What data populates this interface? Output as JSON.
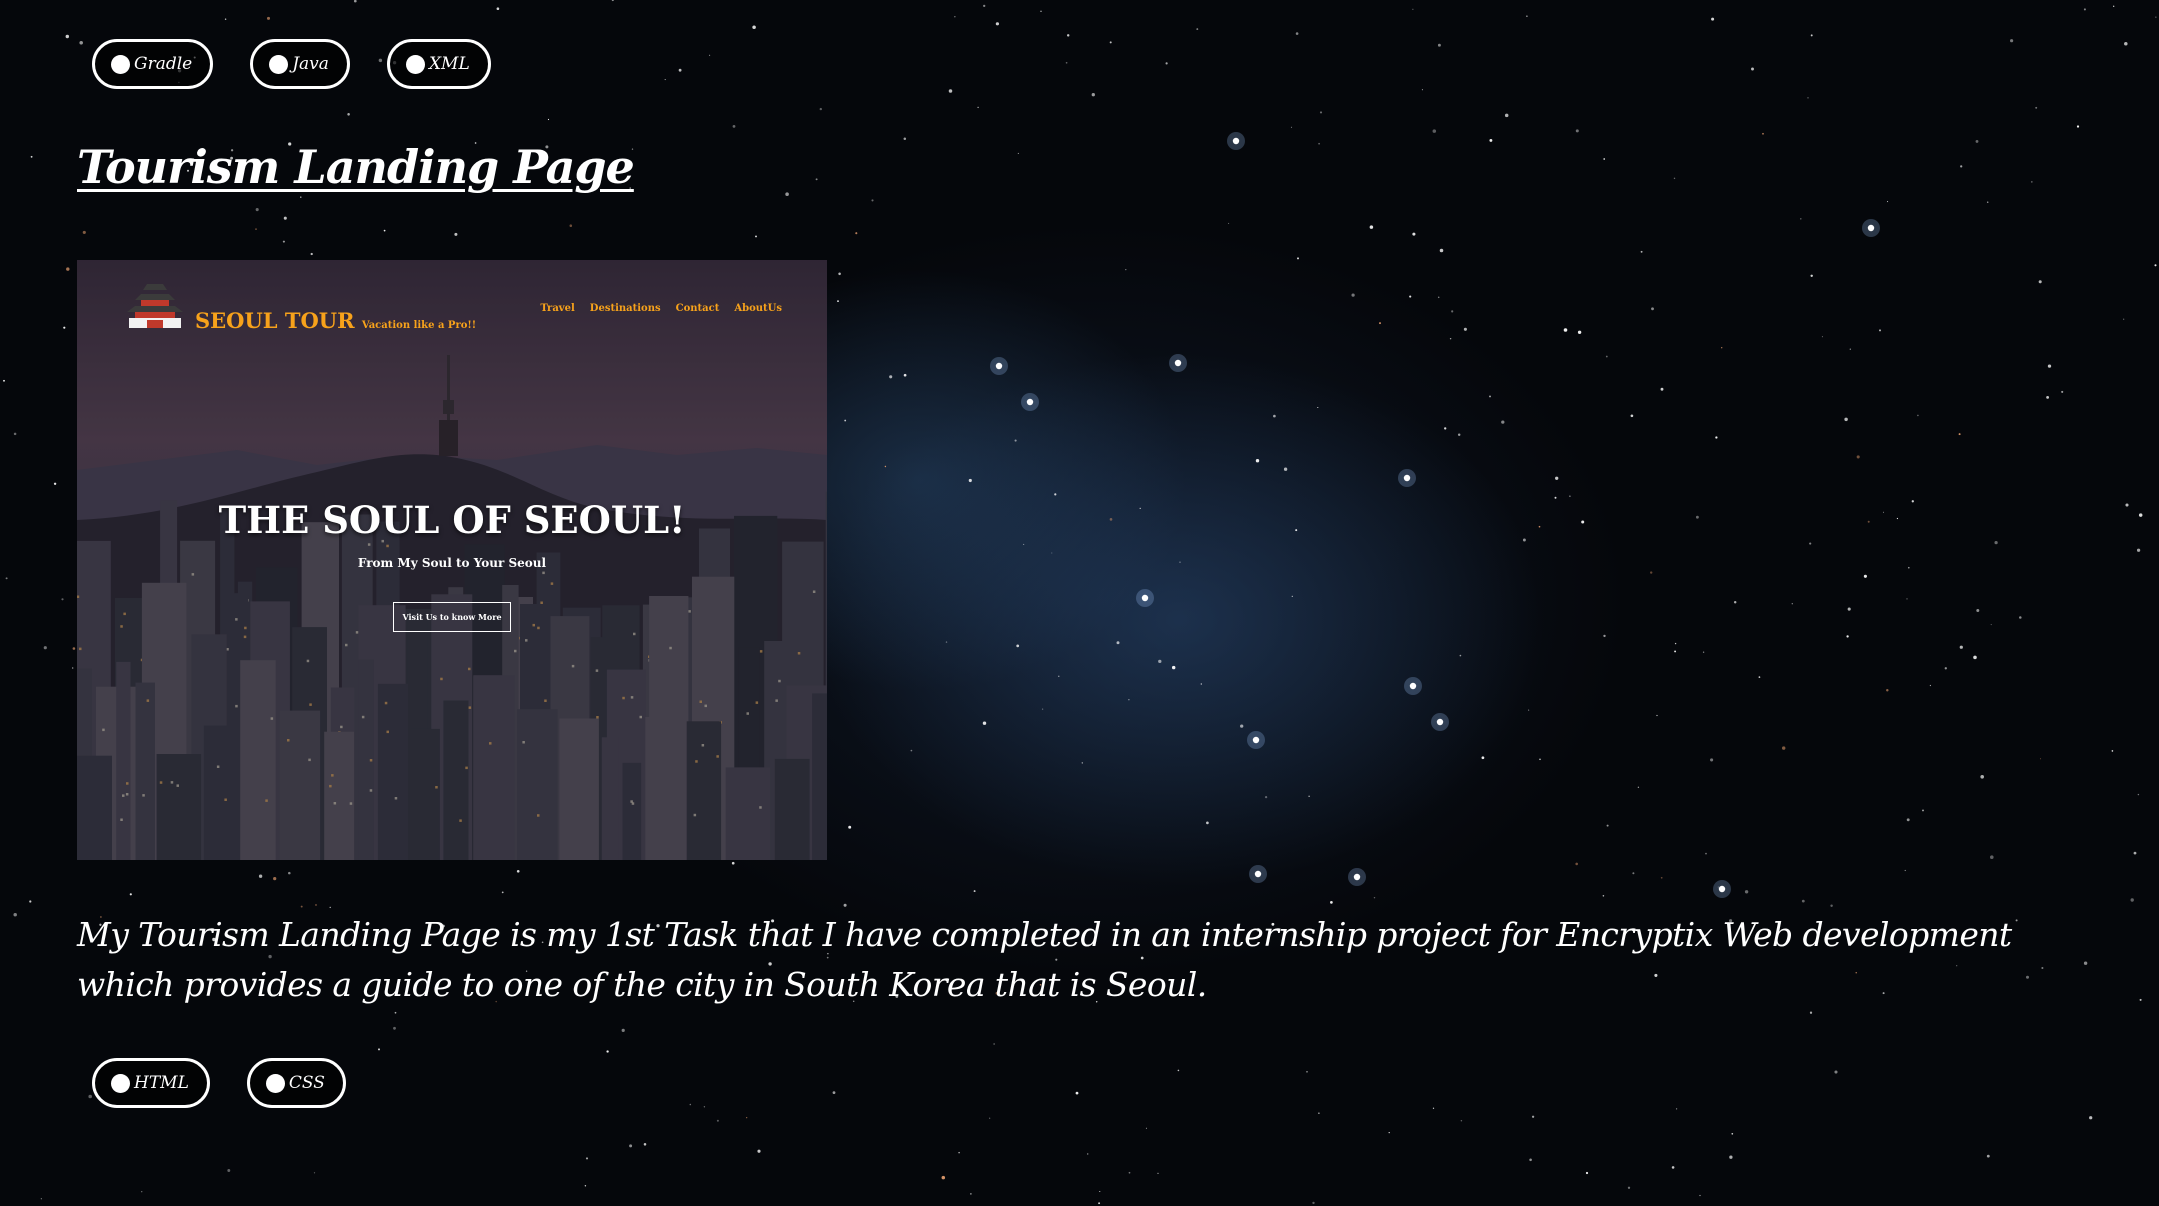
{
  "tags_top": [
    {
      "label": "Gradle"
    },
    {
      "label": "Java"
    },
    {
      "label": "XML"
    }
  ],
  "title": "Tourism Landing Page",
  "preview": {
    "brand": "SEOUL TOUR",
    "tagline": "Vacation like a Pro!!",
    "nav": [
      "Travel",
      "Destinations",
      "Contact",
      "AboutUs"
    ],
    "heading": "THE SOUL OF SEOUL!",
    "subheading": "From My Soul to Your Seoul",
    "button": "Visit Us to know More",
    "brand_color": "#f7a21b"
  },
  "description": "My Tourism Landing Page is my 1st Task that I have completed in an internship project for Encryptix Web development which provides a guide to one of the city in South Korea that is Seoul.",
  "tags_bottom": [
    {
      "label": "HTML"
    },
    {
      "label": "CSS"
    }
  ],
  "colors": {
    "background": "#05070b",
    "text": "#ffffff"
  }
}
